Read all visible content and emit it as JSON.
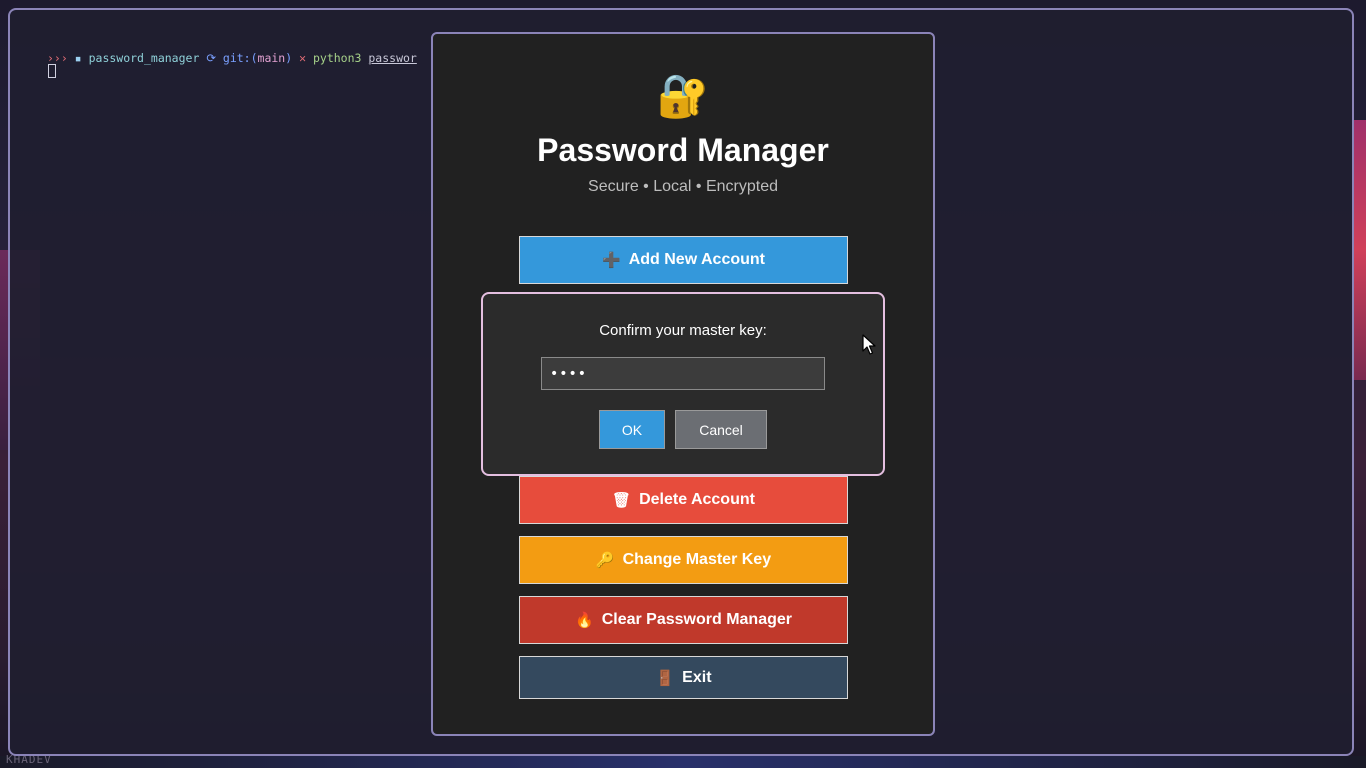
{
  "terminal": {
    "prompt_arrows": "›››",
    "folder_icon": "folder-icon",
    "directory": "password_manager",
    "git_label": "git:(",
    "branch": "main",
    "git_close": ")",
    "dirty_mark": "✕",
    "command": "python3",
    "argument": "passwor"
  },
  "wallpaper_text": "KHADEV",
  "app": {
    "icon": "🔐",
    "title": "Password Manager",
    "subtitle": "Secure • Local • Encrypted",
    "buttons": {
      "add": {
        "icon": "➕",
        "label": "Add New Account",
        "color": "#3498db"
      },
      "delete": {
        "icon": "🗑",
        "label": "Delete Account",
        "color": "#e74c3c"
      },
      "change": {
        "icon": "🔑",
        "label": "Change Master Key",
        "color": "#f39c12"
      },
      "clear": {
        "icon": "🔥",
        "label": "Clear Password Manager",
        "color": "#c0392b"
      },
      "exit": {
        "icon": "🚪",
        "label": "Exit",
        "color": "#34495e"
      }
    }
  },
  "dialog": {
    "label": "Confirm your master key:",
    "value": "••••",
    "ok_label": "OK",
    "cancel_label": "Cancel"
  }
}
